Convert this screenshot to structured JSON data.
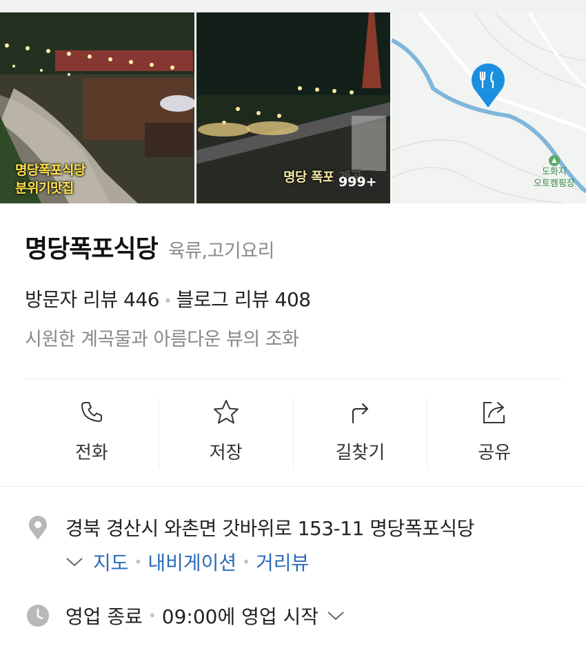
{
  "photos": [
    {
      "caption_line1": "명당폭포식당",
      "caption_line2": "분위기맛집"
    },
    {
      "caption": "명당 폭포 계곡",
      "count_badge": "999+"
    },
    {
      "map_place_label": "도화지\n오토캠핑장"
    }
  ],
  "place": {
    "name": "명당폭포식당",
    "category": "육류,고기요리",
    "visitor_reviews": "방문자 리뷰 446",
    "blog_reviews": "블로그 리뷰 408",
    "description": "시원한 계곡물과 아름다운 뷰의 조화"
  },
  "actions": [
    {
      "label": "전화",
      "icon": "phone-icon"
    },
    {
      "label": "저장",
      "icon": "star-icon"
    },
    {
      "label": "길찾기",
      "icon": "directions-icon"
    },
    {
      "label": "공유",
      "icon": "share-icon"
    }
  ],
  "address": {
    "text": "경북 경산시 와촌면 갓바위로 153-11 명당폭포식당",
    "links": [
      "지도",
      "내비게이션",
      "거리뷰"
    ]
  },
  "hours": {
    "status": "영업 종료",
    "next": "09:00에 영업 시작"
  },
  "colors": {
    "link": "#2a6bb8",
    "pin": "#1a8fe0",
    "muted": "#888888"
  }
}
